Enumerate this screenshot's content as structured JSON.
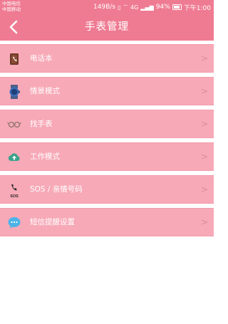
{
  "status": {
    "carrier1": "中国电信",
    "carrier2": "中国移动",
    "speed": "149B/s",
    "network": "4G",
    "battery": "94%",
    "time": "下午1:00"
  },
  "header": {
    "back_icon": "chevron-left-icon",
    "title": "手表管理"
  },
  "menu": [
    {
      "label": "电话本",
      "icon": "phonebook-icon",
      "arrow": ">"
    },
    {
      "label": "情景模式",
      "icon": "watch-icon",
      "arrow": ">"
    },
    {
      "label": "找手表",
      "icon": "find-watch-icon",
      "arrow": ">"
    },
    {
      "label": "工作模式",
      "icon": "cloud-upload-icon",
      "arrow": ">"
    },
    {
      "label": "SOS / 亲情号码",
      "icon": "sos-phone-icon",
      "icon_text": "SOS",
      "arrow": ">"
    },
    {
      "label": "短信提醒设置",
      "icon": "sms-icon",
      "arrow": ">"
    }
  ]
}
